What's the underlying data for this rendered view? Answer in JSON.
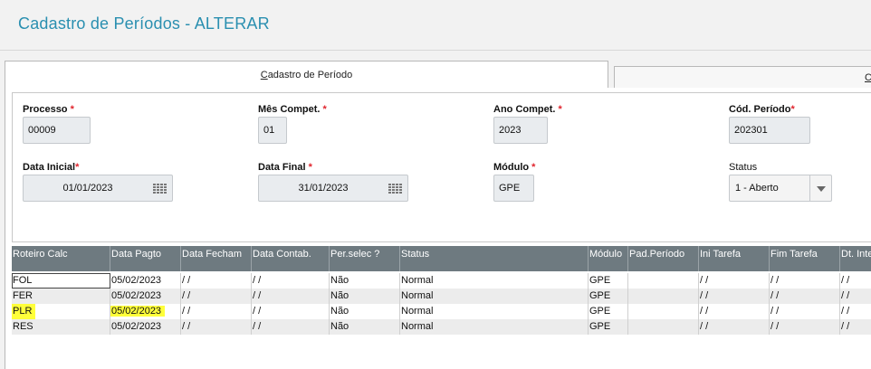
{
  "window": {
    "title": "Cadastro de Períodos - ALTERAR"
  },
  "tabs": [
    {
      "label_prefix": "",
      "label_u": "C",
      "label_rest": "adastro de Período"
    },
    {
      "label_u": "C"
    }
  ],
  "form": {
    "processo": {
      "label": "Processo",
      "required": "*",
      "value": "00009"
    },
    "mes_compet": {
      "label": "Mês Compet.",
      "required": "*",
      "value": "01"
    },
    "ano_compet": {
      "label": "Ano Compet.",
      "required": "*",
      "value": "2023"
    },
    "cod_periodo": {
      "label": "Cód. Período",
      "required": "*",
      "value": "202301"
    },
    "data_inicial": {
      "label": "Data Inicial",
      "required": "*",
      "value": "01/01/2023"
    },
    "data_final": {
      "label": "Data Final",
      "required": "*",
      "value": "31/01/2023"
    },
    "modulo": {
      "label": "Módulo",
      "required": "*",
      "value": "GPE"
    },
    "status": {
      "label": "Status",
      "value": "1 - Aberto"
    }
  },
  "grid": {
    "columns": [
      "Roteiro Calc",
      "Data Pagto",
      "Data Fecham",
      "Data Contab.",
      "Per.selec ?",
      "Status",
      "Módulo",
      "Pad.Período",
      "Ini Tarefa",
      "Fim Tarefa",
      "Dt. Inte"
    ],
    "rows": [
      [
        "FOL",
        "05/02/2023",
        " / /",
        " / /",
        "Não",
        "Normal",
        "GPE",
        "",
        " / /",
        " / /",
        " / /"
      ],
      [
        "FER",
        "05/02/2023",
        " / /",
        " / /",
        "Não",
        "Normal",
        "GPE",
        "",
        " / /",
        " / /",
        " / /"
      ],
      [
        "PLR",
        "05/02/2023",
        " / /",
        " / /",
        "Não",
        "Normal",
        "GPE",
        "",
        " / /",
        " / /",
        " / /"
      ],
      [
        "RES",
        "05/02/2023",
        " / /",
        " / /",
        "Não",
        "Normal",
        "GPE",
        "",
        " / /",
        " / /",
        " / /"
      ]
    ]
  },
  "colors": {
    "title": "#2a8fb0",
    "required": "#e0242d",
    "grid_header": "#6e7a80",
    "highlight": "#ffff3a"
  }
}
